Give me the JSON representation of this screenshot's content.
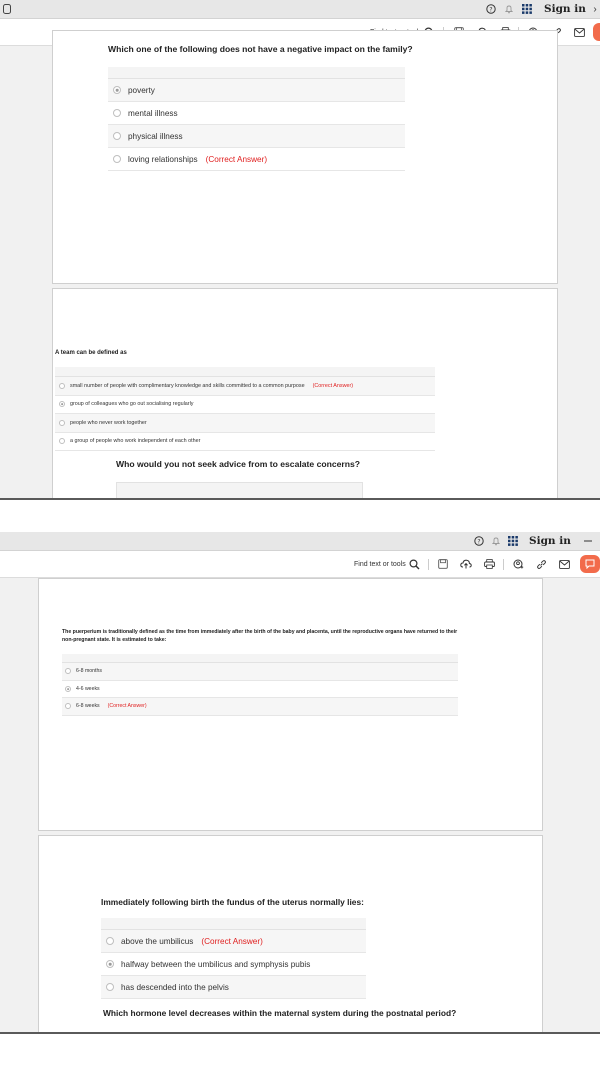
{
  "toolbar": {
    "sign_in_label": "Sign in",
    "find_text_label": "Find text or tools",
    "help_icon": "help-circle-icon",
    "bell_icon": "bell-icon",
    "apps_icon": "apps-grid-icon"
  },
  "screen1": {
    "q1": {
      "text": "Which one of the following does not have a negative impact on the family?",
      "options": [
        {
          "label": "poverty",
          "selected": true,
          "correct": false
        },
        {
          "label": "mental illness",
          "selected": false,
          "correct": false
        },
        {
          "label": "physical illness",
          "selected": false,
          "correct": false
        },
        {
          "label": "loving relationships",
          "selected": false,
          "correct": true
        }
      ]
    },
    "q2": {
      "text": "A team can be defined as",
      "options": [
        {
          "label": "small number of people with complimentary knowledge and skills committed to a common purpose",
          "selected": false,
          "correct": true
        },
        {
          "label": "group of colleagues who go out socialising regularly",
          "selected": true,
          "correct": false
        },
        {
          "label": "people who never work together",
          "selected": false,
          "correct": false
        },
        {
          "label": "a group of people who work independent of each other",
          "selected": false,
          "correct": false
        }
      ]
    },
    "q3": {
      "text": "Who would you not seek advice from to escalate concerns?"
    }
  },
  "screen2": {
    "q1": {
      "text": "The puerperium is traditionally defined as the time from immediately after the birth of the baby and placenta, until the reproductive organs have returned to their non-pregnant state. It is estimated to take:",
      "options": [
        {
          "label": "6-8 months",
          "selected": false,
          "correct": false
        },
        {
          "label": "4-6 weeks",
          "selected": true,
          "correct": false
        },
        {
          "label": "6-8 weeks",
          "selected": false,
          "correct": true
        }
      ]
    },
    "q2": {
      "text": "Immediately following birth the fundus of the uterus normally lies:",
      "options": [
        {
          "label": "above the umbilicus",
          "selected": false,
          "correct": true
        },
        {
          "label": "halfway between the umbilicus and symphysis pubis",
          "selected": true,
          "correct": false
        },
        {
          "label": "has descended into the pelvis",
          "selected": false,
          "correct": false
        }
      ]
    },
    "q3": {
      "text": "Which hormone level decreases within the maternal system during the postnatal period?"
    }
  },
  "correct_answer_label": "(Correct Answer)",
  "colors": {
    "accent": "#f26b4b",
    "correct": "#e02020"
  }
}
